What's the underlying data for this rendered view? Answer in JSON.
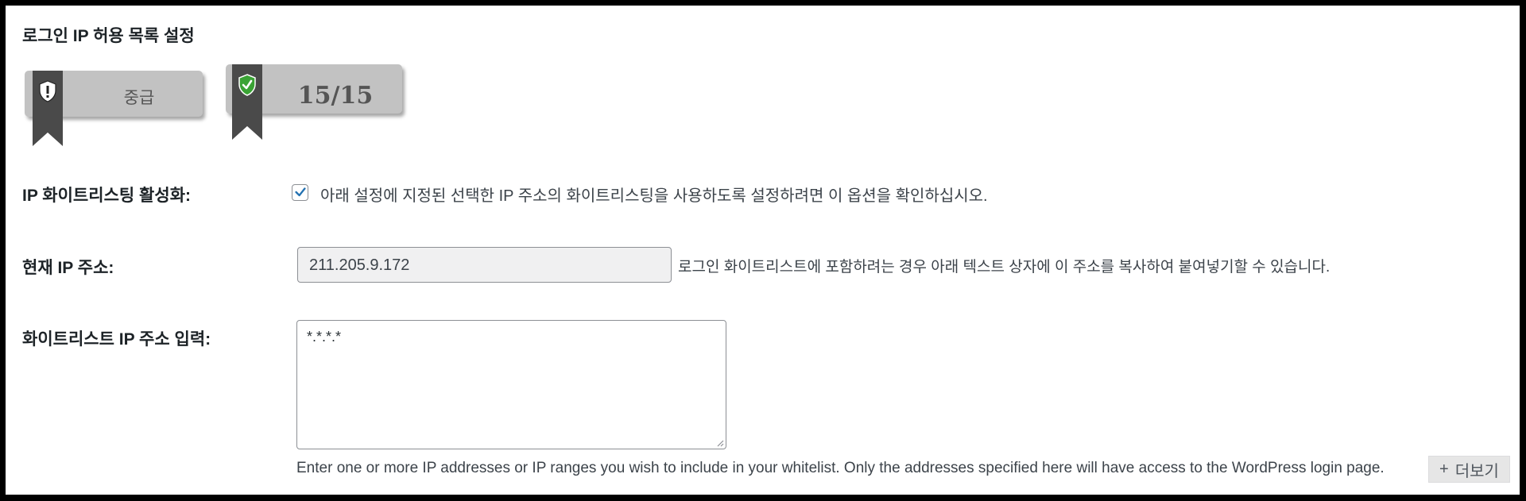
{
  "section": {
    "title": "로그인 IP 허용 목록 설정"
  },
  "badges": {
    "grade": {
      "label": "중급",
      "icon": "shield-exclamation-icon"
    },
    "score": {
      "label": "15/15",
      "icon": "shield-check-icon"
    }
  },
  "whitelist_enable": {
    "label": "IP 화이트리스팅 활성화:",
    "checked": true,
    "description": "아래 설정에 지정된 선택한 IP 주소의 화이트리스팅을 사용하도록 설정하려면 이 옵션을 확인하십시오."
  },
  "current_ip": {
    "label": "현재 IP 주소:",
    "value": "211.205.9.172",
    "description": "로그인 화이트리스트에 포함하려는 경우 아래 텍스트 상자에 이 주소를 복사하여 붙여넣기할 수 있습니다."
  },
  "whitelist_input": {
    "label": "화이트리스트 IP 주소 입력:",
    "value": "*.*.*.*",
    "help": "Enter one or more IP addresses or IP ranges you wish to include in your whitelist. Only the addresses specified here will have access to the WordPress login page."
  },
  "more_button": {
    "icon": "+",
    "label": "더보기"
  },
  "colors": {
    "badge_bg": "#c2c2c2",
    "ribbon": "#4a4a4a",
    "check": "#2271b1",
    "shield_green": "#3aa335"
  }
}
